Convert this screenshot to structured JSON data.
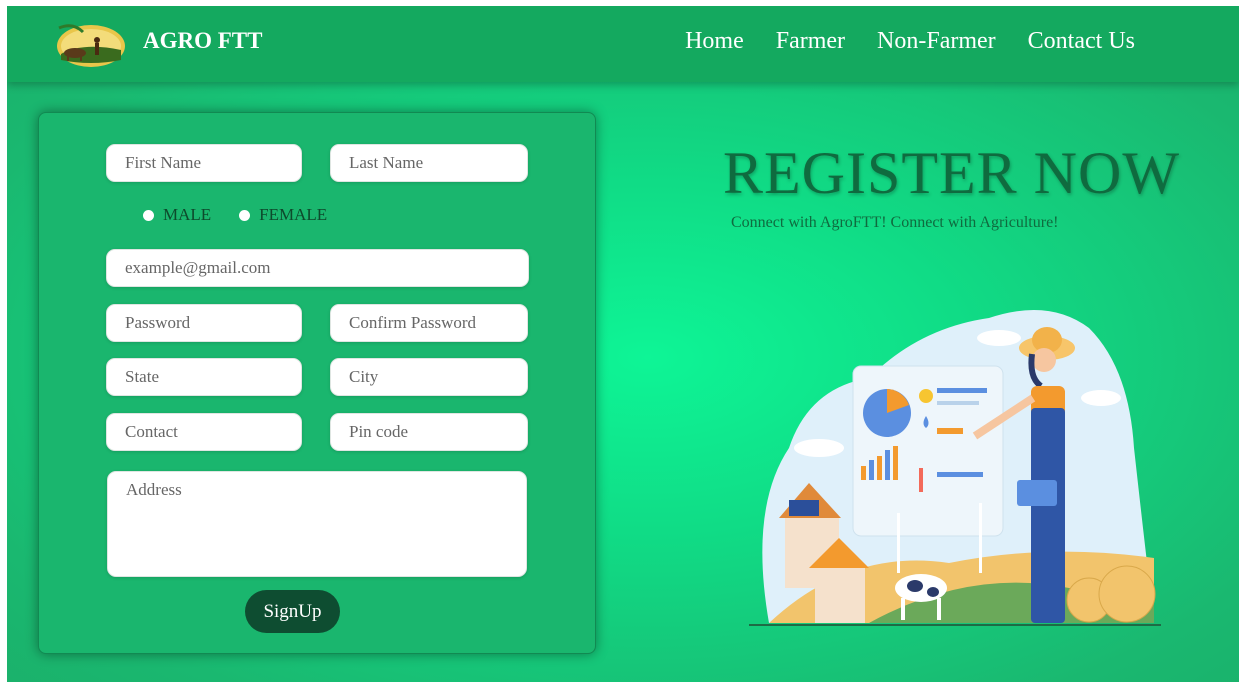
{
  "navbar": {
    "brand": "AGRO FTT",
    "links": [
      "Home",
      "Farmer",
      "Non-Farmer",
      "Contact Us"
    ]
  },
  "form": {
    "first_name_placeholder": "First Name",
    "last_name_placeholder": "Last Name",
    "gender_options": [
      "MALE",
      "FEMALE"
    ],
    "email_placeholder": "example@gmail.com",
    "password_placeholder": "Password",
    "confirm_password_placeholder": "Confirm Password",
    "state_placeholder": "State",
    "city_placeholder": "City",
    "contact_placeholder": "Contact",
    "pincode_placeholder": "Pin code",
    "address_placeholder": "Address",
    "submit_label": "SignUp"
  },
  "hero": {
    "title": "REGISTER NOW",
    "subtitle": "Connect with AgroFTT! Connect with Agriculture!"
  },
  "colors": {
    "navbar": "#14a95f",
    "background": "#10dc86",
    "headline": "#0f6b3f",
    "button": "#0e4d31"
  }
}
